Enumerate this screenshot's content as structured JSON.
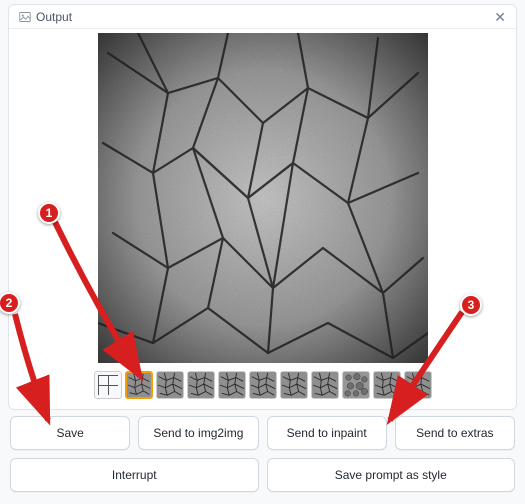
{
  "panel": {
    "title": "Output"
  },
  "thumbnails": [
    {
      "kind": "grid",
      "selected": false
    },
    {
      "kind": "crack",
      "selected": true
    },
    {
      "kind": "crack",
      "selected": false
    },
    {
      "kind": "crack",
      "selected": false
    },
    {
      "kind": "crack",
      "selected": false
    },
    {
      "kind": "crack",
      "selected": false
    },
    {
      "kind": "crack",
      "selected": false
    },
    {
      "kind": "crack",
      "selected": false
    },
    {
      "kind": "pebble",
      "selected": false
    },
    {
      "kind": "crack",
      "selected": false
    },
    {
      "kind": "crack",
      "selected": false
    }
  ],
  "buttons": {
    "save": "Save",
    "send_img2img": "Send to img2img",
    "send_inpaint": "Send to inpaint",
    "send_extras": "Send to extras",
    "interrupt": "Interrupt",
    "save_style": "Save prompt as style"
  },
  "annotations": {
    "m1": "1",
    "m2": "2",
    "m3": "3"
  }
}
